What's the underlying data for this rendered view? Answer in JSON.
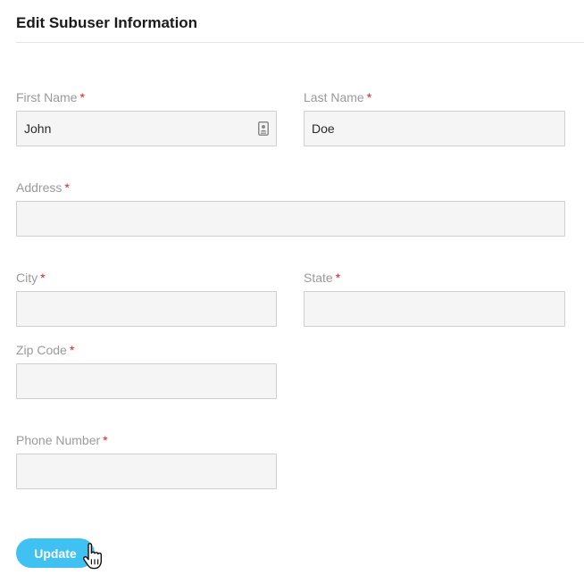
{
  "page": {
    "title": "Edit Subuser Information"
  },
  "form": {
    "required_marker": "*",
    "first_name": {
      "label": "First Name",
      "value": "John"
    },
    "last_name": {
      "label": "Last Name",
      "value": "Doe"
    },
    "address": {
      "label": "Address",
      "value": ""
    },
    "city": {
      "label": "City",
      "value": ""
    },
    "state": {
      "label": "State",
      "value": ""
    },
    "zip_code": {
      "label": "Zip Code",
      "value": ""
    },
    "phone_number": {
      "label": "Phone Number",
      "value": ""
    },
    "submit_label": "Update"
  },
  "icons": {
    "autofill": "contact-card-icon",
    "cursor": "hand-pointer-icon"
  },
  "colors": {
    "button": "#3fc1f2",
    "required": "#e02020",
    "label": "#9a9a9a",
    "input_background": "#f5f5f5"
  }
}
